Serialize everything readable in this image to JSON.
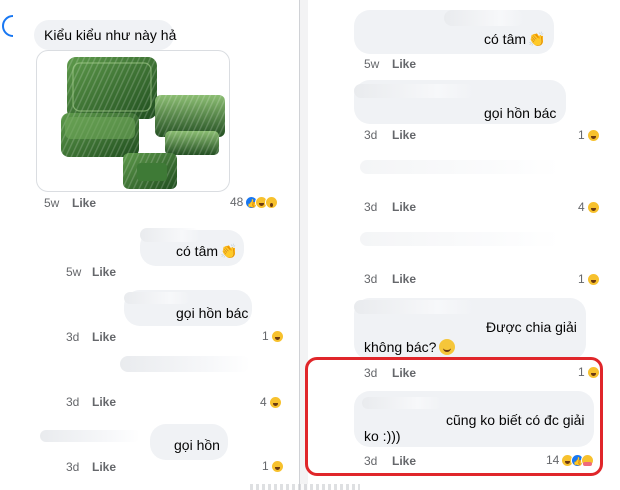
{
  "left": {
    "top_comment": {
      "text": "Kiểu kiểu như này hả",
      "time": "5w",
      "like": "Like",
      "reaction_count": "48"
    },
    "image": {
      "alt": "green plastic leaf-pattern food containers"
    },
    "replies": [
      {
        "text": "có tâm",
        "time": "5w",
        "like": "Like",
        "reaction_count": ""
      },
      {
        "text": "gọi hồn bác",
        "time": "3d",
        "like": "Like",
        "reaction_count": "1"
      },
      {
        "text": "",
        "time": "3d",
        "like": "Like",
        "reaction_count": "4"
      },
      {
        "text": "gọi hồn",
        "time": "3d",
        "like": "Like",
        "reaction_count": "1"
      }
    ]
  },
  "right": {
    "comments": [
      {
        "text": "có tâm",
        "time": "5w",
        "like": "Like",
        "reaction_count": ""
      },
      {
        "text": "gọi hồn bác",
        "time": "3d",
        "like": "Like",
        "reaction_count": "1"
      },
      {
        "text": "",
        "time": "3d",
        "like": "Like",
        "reaction_count": "4"
      },
      {
        "text": "",
        "time": "3d",
        "like": "Like",
        "reaction_count": "1"
      },
      {
        "text_line1": "Được chia giải",
        "text_line2": "không bác?",
        "time": "3d",
        "like": "Like",
        "reaction_count": "1"
      },
      {
        "text_line1": "cũng ko biết có đc giải",
        "text_line2": "ko :)))",
        "time": "3d",
        "like": "Like",
        "reaction_count": "14"
      }
    ]
  },
  "colors": {
    "bubble": "#f0f2f5",
    "meta": "#65676b",
    "highlight": "#e0262a",
    "like_blue": "#1877f2"
  },
  "icons": [
    "facebook-logo-icon",
    "clapping-hands-icon",
    "grinning-face-icon",
    "haha-reaction-icon",
    "like-reaction-icon",
    "wow-reaction-icon",
    "care-reaction-icon"
  ]
}
